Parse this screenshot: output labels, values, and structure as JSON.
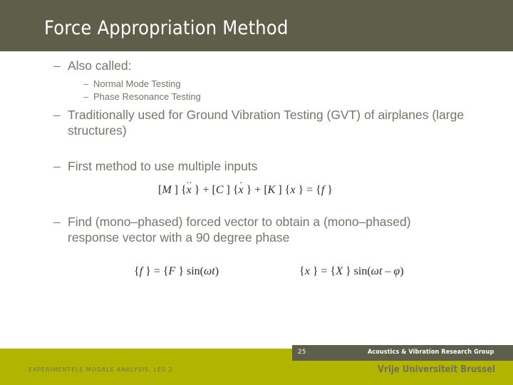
{
  "slide": {
    "title": "Force Appropriation Method",
    "bullets": {
      "also_called": {
        "marker": "–",
        "text": "Also called:"
      },
      "normal_mode": {
        "marker": "–",
        "text": "Normal Mode Testing"
      },
      "phase_resonance": {
        "marker": "–",
        "text": "Phase Resonance Testing"
      },
      "traditionally": {
        "marker": "–",
        "text": "Traditionally used for Ground Vibration Testing (GVT) of airplanes (large structures)"
      },
      "first_method": {
        "marker": "–",
        "text": "First method to use multiple inputs"
      },
      "find_vector": {
        "marker": "–",
        "text": "Find (mono–phased) forced vector to obtain a (mono–phased) response vector with a 90 degree phase"
      }
    },
    "equations": {
      "motion": "[M ] {ẍ } + [C ] {ẋ } + [K ] {x } = {f }",
      "force": "{f } = {F } sin(ωt)",
      "response": "{x } = {X } sin(ωt – φ)"
    }
  },
  "footer": {
    "page_number": "25",
    "research_group": "Acoustics & Vibration Research Group",
    "university": "Vrije Universiteit Brussel",
    "course": "EXPERIMENTELE MODALE ANALYSIS, LES 2"
  },
  "colors": {
    "header_olive": "#5d5f4a",
    "footer_yellow": "#b2b500",
    "body_text": "#7a736a",
    "university_text": "#6f7359"
  }
}
